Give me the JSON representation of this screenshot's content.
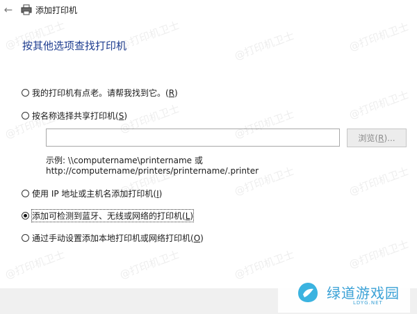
{
  "window": {
    "title": "添加打印机",
    "heading": "按其他选项查找打印机"
  },
  "options": [
    {
      "label": "我的打印机有点老。请帮我找到它。",
      "key": "R",
      "checked": false
    },
    {
      "label": "按名称选择共享打印机",
      "key": "S",
      "checked": false
    },
    {
      "label": "使用 IP 地址或主机名添加打印机",
      "key": "I",
      "checked": false
    },
    {
      "label": "添加可检测到蓝牙、无线或网络的打印机",
      "key": "L",
      "checked": true
    },
    {
      "label": "通过手动设置添加本地打印机或网络打印机",
      "key": "O",
      "checked": false
    }
  ],
  "share": {
    "input_value": "",
    "browse_label": "浏览(",
    "browse_key": "R",
    "browse_tail": ")...",
    "example_line1": "示例: \\\\computername\\printername 或",
    "example_line2": "http://computername/printers/printername/.printer"
  },
  "watermark": "@打印机卫士",
  "logo": {
    "text": "绿道游戏园",
    "sub": "LDYG.NET"
  }
}
